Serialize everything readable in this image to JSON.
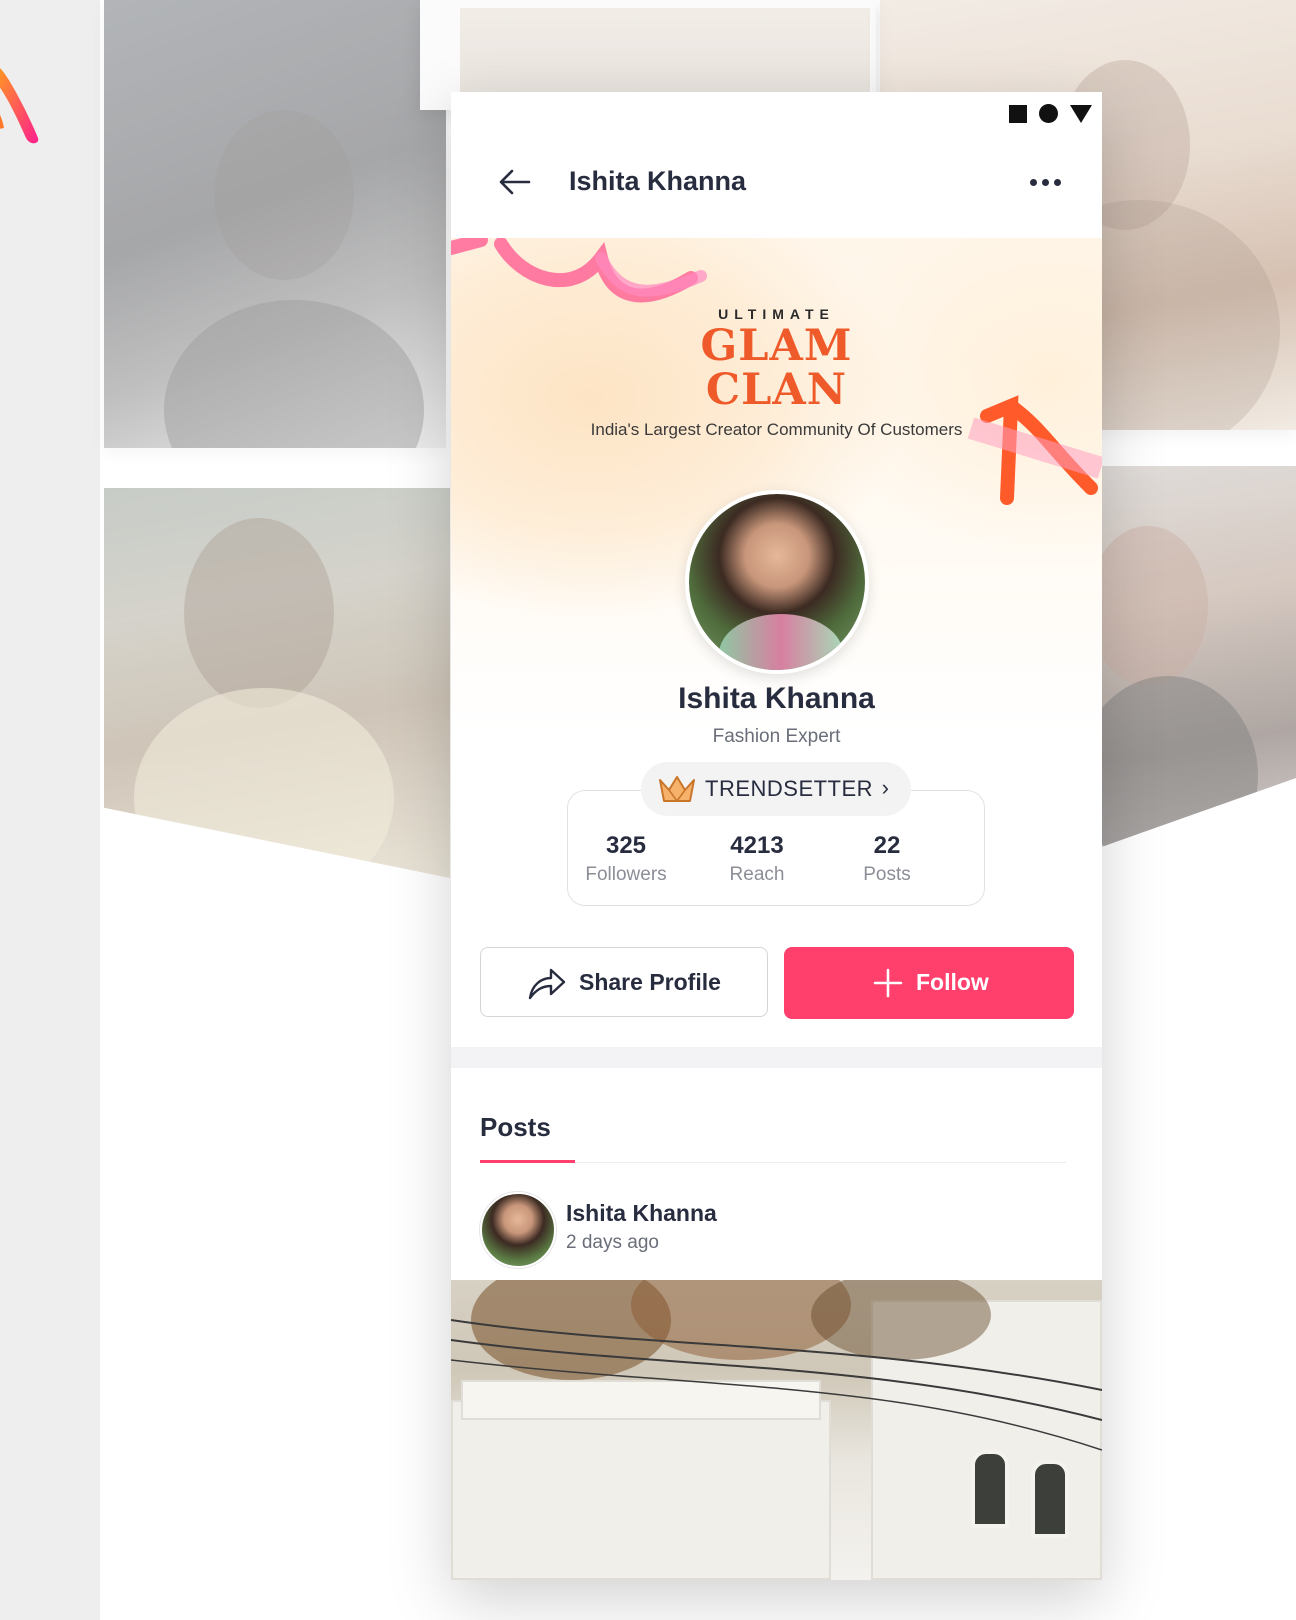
{
  "header": {
    "title": "Ishita Khanna"
  },
  "banner": {
    "kicker": "ULTIMATE",
    "brand_line1": "GLAM",
    "brand_line2": "CLAN",
    "tagline": "India's Largest Creator Community Of Customers"
  },
  "profile": {
    "name": "Ishita Khanna",
    "role": "Fashion Expert",
    "badge": "TRENDSETTER",
    "stats": [
      {
        "value": "325",
        "label": "Followers"
      },
      {
        "value": "4213",
        "label": "Reach"
      },
      {
        "value": "22",
        "label": "Posts"
      }
    ]
  },
  "actions": {
    "share_label": "Share Profile",
    "follow_label": "Follow"
  },
  "posts": {
    "tab_label": "Posts",
    "items": [
      {
        "author": "Ishita Khanna",
        "time": "2 days ago"
      }
    ]
  },
  "colors": {
    "accent": "#ff3f6c",
    "brand_orange": "#ef5a2a",
    "text_primary": "#282c3f",
    "text_secondary": "#696e79"
  },
  "icons": {
    "back": "arrow-left-icon",
    "more": "more-horizontal-icon",
    "badge": "crown-icon",
    "share": "share-arrow-icon",
    "follow": "plus-icon"
  }
}
